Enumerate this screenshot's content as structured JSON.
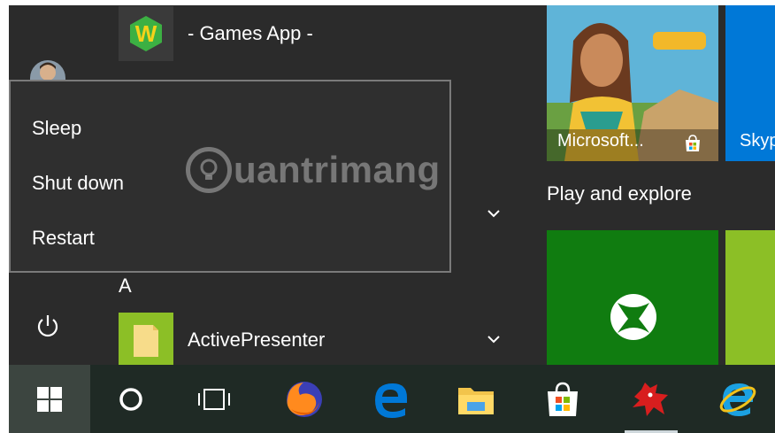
{
  "apps": {
    "games_app_label": "- Games App -",
    "section_letter": "A",
    "active_presenter_label": "ActivePresenter"
  },
  "power_menu": {
    "items": [
      "Sleep",
      "Shut down",
      "Restart"
    ]
  },
  "watermark": {
    "text": "uantrimang"
  },
  "tiles": {
    "microsoft_store_game_label": "Microsoft...",
    "skype_label": "Skyp",
    "section_title": "Play and explore"
  },
  "taskbar": {
    "items": [
      "start-button",
      "search-button",
      "task-view-button",
      "firefox",
      "edge",
      "file-explorer",
      "store",
      "game-app",
      "internet-explorer"
    ]
  },
  "colors": {
    "start_bg": "#2b2b2b",
    "power_menu_bg": "#2f2f2f",
    "xbox_green": "#107c10",
    "lime": "#8cbf26",
    "skype_blue": "#0078d7",
    "taskbar": "#1f2a25"
  }
}
